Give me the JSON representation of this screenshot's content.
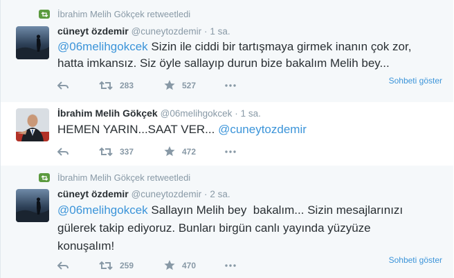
{
  "tweets": [
    {
      "retweet_context": "İbrahim Melih Gökçek retweetledi",
      "fullname": "cüneyt özdemir",
      "username": "@cuneytozdemir",
      "time": "1 sa.",
      "mention": "@06melihgokcek",
      "text_line1_rest": " Sizin ile ciddi bir tartışmaya girmek inanın çok zor,",
      "text_line2": "hatta imkansız. Siz öyle sallayıp durun bize bakalım Melih bey...",
      "retweets": "283",
      "favorites": "527",
      "expand_label": "Sohbeti göster"
    },
    {
      "fullname": "İbrahim Melih Gökçek",
      "username": "@06melihgokcek",
      "time": "1 sa.",
      "text_before": "HEMEN YARIN...SAAT VER... ",
      "mention": "@cuneytozdemir",
      "retweets": "337",
      "favorites": "472"
    },
    {
      "retweet_context": "İbrahim Melih Gökçek retweetledi",
      "fullname": "cüneyt özdemir",
      "username": "@cuneytozdemir",
      "time": "2 sa.",
      "mention": "@06melihgokcek",
      "text_line1_rest": " Sallayın Melih bey  bakalım... Sizin mesajlarınızı",
      "text_line2": "gülerek takip ediyoruz. Bunları birgün canlı yayında yüzyüze",
      "text_line3": "konuşalım!",
      "retweets": "259",
      "favorites": "470",
      "expand_label": "Sohbeti göster"
    }
  ],
  "colors": {
    "link": "#3b94d9",
    "muted": "#8899a6",
    "retweet_badge": "#5b9a3e"
  },
  "icons": [
    "retweet-context-icon",
    "reply-icon",
    "retweet-icon",
    "favorite-icon",
    "more-icon"
  ]
}
